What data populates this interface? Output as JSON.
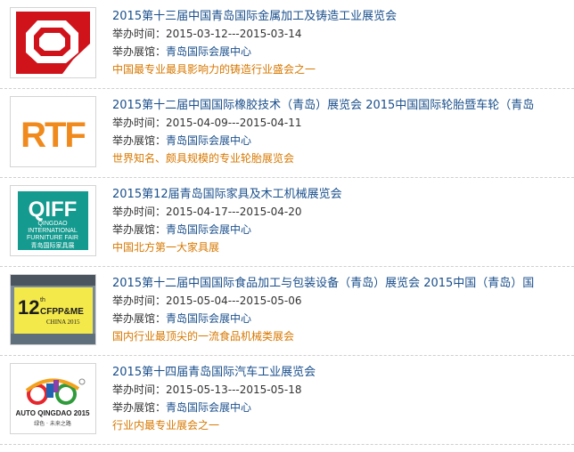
{
  "colors": {
    "title": "#1a4f8b",
    "slogan": "#d77800",
    "divider": "#cfcfcf"
  },
  "labels": {
    "time": "举办时间：",
    "venue": "举办展馆："
  },
  "items": [
    {
      "title": "2015第十三届中国青岛国际金属加工及铸造工业展览会",
      "date": "2015-03-12---2015-03-14",
      "venue": "青岛国际会展中心",
      "slogan": "中国最专业最具影响力的铸造行业盛会之一",
      "logo": "foundry-expo-logo-icon"
    },
    {
      "title": "2015第十二届中国国际橡胶技术（青岛）展览会 2015中国国际轮胎暨车轮（青岛",
      "date": "2015-04-09---2015-04-11",
      "venue": "青岛国际会展中心",
      "slogan": "世界知名、颇具规模的专业轮胎展览会",
      "logo": "rtf-logo-icon",
      "logo_text": "RTF"
    },
    {
      "title": "2015第12届青岛国际家具及木工机械展览会",
      "date": "2015-04-17---2015-04-20",
      "venue": "青岛国际会展中心",
      "slogan": "中国北方第一大家具展",
      "logo": "qiff-logo-icon",
      "logo_text": "QIFF",
      "logo_sub1": "QINGDAO",
      "logo_sub2": "INTERNATIONAL",
      "logo_sub3": "FURNITURE FAIR",
      "logo_sub4": "青岛国际家具展"
    },
    {
      "title": "2015第十二届中国国际食品加工与包装设备（青岛）展览会 2015中国（青岛）国",
      "date": "2015-05-04---2015-05-06",
      "venue": "青岛国际会展中心",
      "slogan": "国内行业最顶尖的一流食品机械类展会",
      "logo": "cfppme-logo-icon",
      "logo_text": "CFPP&ME",
      "logo_num": "12",
      "logo_sup": "th",
      "logo_sub": "CHINA 2015"
    },
    {
      "title": "2015第十四届青岛国际汽车工业展览会",
      "date": "2015-05-13---2015-05-18",
      "venue": "青岛国际会展中心",
      "slogan": "行业内最专业展会之一",
      "logo": "auto-qingdao-logo-icon",
      "logo_text": "AUTO QINGDAO 2015",
      "logo_sub": "绿色 · 未来之路"
    }
  ]
}
